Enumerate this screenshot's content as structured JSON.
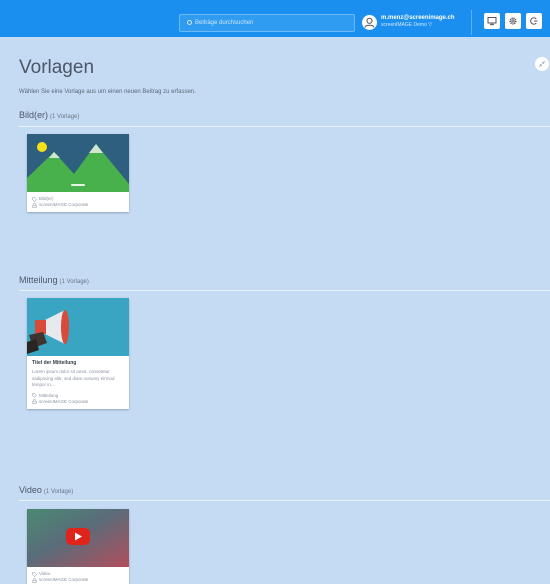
{
  "topbar": {
    "search_placeholder": "Beiträge durchsuchen",
    "user_email": "m.menz@screenimage.ch",
    "user_org": "screenIMAGE Demo ▽",
    "icons": [
      "monitor-icon",
      "gear-icon",
      "logout-icon"
    ]
  },
  "page": {
    "title": "Vorlagen",
    "subtitle": "Wählen Sie eine Vorlage aus um einen neuen Beitrag zu erfassen."
  },
  "sections": [
    {
      "title": "Bild(er)",
      "count": "(1 Vorlage)",
      "card": {
        "thumbnail": "landscape-placeholder",
        "type": "Bild(er)",
        "owner": "screenIMAGE Corporate"
      }
    },
    {
      "title": "Mitteilung",
      "count": "(1 Vorlage)",
      "card": {
        "thumbnail": "megaphone",
        "title": "Titel der Mitteilung",
        "text": "Lorem ipsum dolor sit amet, consetetur sadipscing elitr, sed diam nonumy eirmod tempor in...",
        "type": "Mitteilung",
        "owner": "screenIMAGE Corporate"
      }
    },
    {
      "title": "Video",
      "count": "(1 Vorlage)",
      "card": {
        "thumbnail": "video-play",
        "type": "Video",
        "owner": "screenIMAGE Corporate"
      }
    }
  ],
  "colors": {
    "topbar": "#1a8ff0",
    "background": "#c5dbf4",
    "card": "#ffffff"
  }
}
